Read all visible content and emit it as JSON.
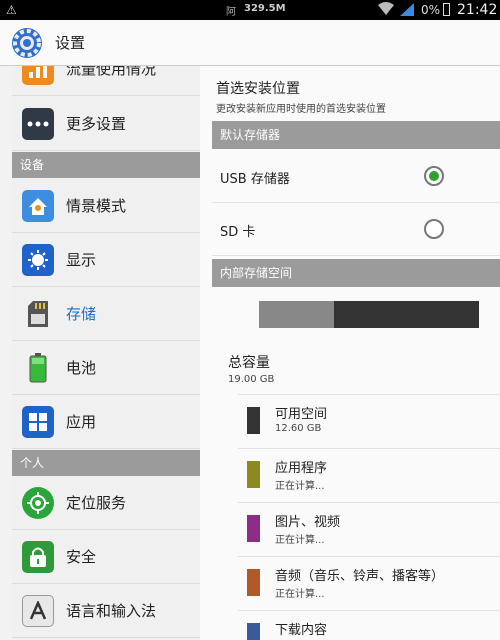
{
  "status_bar": {
    "carrier": "阿",
    "speed": "329.5M",
    "battery_pct": "0%",
    "time": "21:42"
  },
  "action_bar": {
    "title": "设置"
  },
  "sidebar": {
    "items": [
      {
        "label": "流量使用情况",
        "icon": "data-usage-icon",
        "color": "#f08a1c"
      },
      {
        "label": "更多设置",
        "icon": "more-icon",
        "color": "#2f3a46"
      },
      {
        "label": "情景模式",
        "icon": "profile-icon",
        "color": "#3d8de0"
      },
      {
        "label": "显示",
        "icon": "display-icon",
        "color": "#1f62c9"
      },
      {
        "label": "存储",
        "icon": "sd-card-icon",
        "color": "#4a4a4a"
      },
      {
        "label": "电池",
        "icon": "battery-icon",
        "color": "#39b93a"
      },
      {
        "label": "应用",
        "icon": "apps-icon",
        "color": "#1f62c9"
      },
      {
        "label": "定位服务",
        "icon": "location-icon",
        "color": "#2aa53a"
      },
      {
        "label": "安全",
        "icon": "lock-icon",
        "color": "#2f9a3a"
      },
      {
        "label": "语言和输入法",
        "icon": "language-icon",
        "color": "#e8e8e8"
      }
    ],
    "categories": [
      "设备",
      "个人"
    ]
  },
  "main": {
    "install_location": {
      "title": "首选安装位置",
      "subtitle": "更改安装新应用时使用的首选安装位置"
    },
    "default_storage_header": "默认存储器",
    "storage_options": [
      {
        "label": "USB 存储器",
        "selected": true
      },
      {
        "label": "SD 卡",
        "selected": false
      }
    ],
    "internal_header": "内部存储空间",
    "usage_used_fraction": 0.34,
    "total": {
      "title": "总容量",
      "value": "19.00 GB"
    },
    "breakdown": [
      {
        "label": "可用空间",
        "value": "12.60 GB",
        "color": "#333333"
      },
      {
        "label": "应用程序",
        "value": "正在计算...",
        "color": "#8a8a1e"
      },
      {
        "label": "图片、视频",
        "value": "正在计算...",
        "color": "#8a2e8a"
      },
      {
        "label": "音频（音乐、铃声、播客等）",
        "value": "正在计算...",
        "color": "#b05a28"
      },
      {
        "label": "下载内容",
        "value": "",
        "color": "#3a5a9a"
      }
    ]
  }
}
